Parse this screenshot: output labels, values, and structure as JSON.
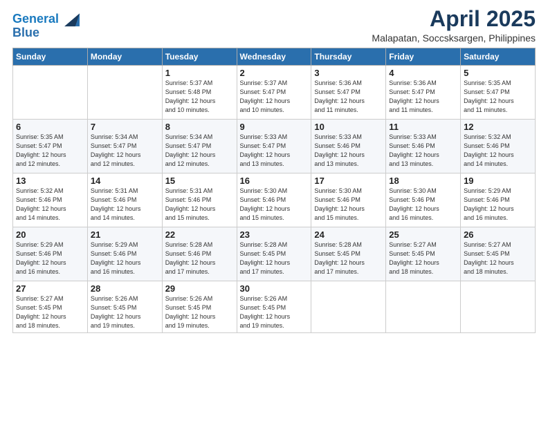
{
  "logo": {
    "line1": "General",
    "line2": "Blue"
  },
  "title": "April 2025",
  "subtitle": "Malapatan, Soccsksargen, Philippines",
  "weekdays": [
    "Sunday",
    "Monday",
    "Tuesday",
    "Wednesday",
    "Thursday",
    "Friday",
    "Saturday"
  ],
  "weeks": [
    [
      {
        "day": "",
        "info": ""
      },
      {
        "day": "",
        "info": ""
      },
      {
        "day": "1",
        "info": "Sunrise: 5:37 AM\nSunset: 5:48 PM\nDaylight: 12 hours\nand 10 minutes."
      },
      {
        "day": "2",
        "info": "Sunrise: 5:37 AM\nSunset: 5:47 PM\nDaylight: 12 hours\nand 10 minutes."
      },
      {
        "day": "3",
        "info": "Sunrise: 5:36 AM\nSunset: 5:47 PM\nDaylight: 12 hours\nand 11 minutes."
      },
      {
        "day": "4",
        "info": "Sunrise: 5:36 AM\nSunset: 5:47 PM\nDaylight: 12 hours\nand 11 minutes."
      },
      {
        "day": "5",
        "info": "Sunrise: 5:35 AM\nSunset: 5:47 PM\nDaylight: 12 hours\nand 11 minutes."
      }
    ],
    [
      {
        "day": "6",
        "info": "Sunrise: 5:35 AM\nSunset: 5:47 PM\nDaylight: 12 hours\nand 12 minutes."
      },
      {
        "day": "7",
        "info": "Sunrise: 5:34 AM\nSunset: 5:47 PM\nDaylight: 12 hours\nand 12 minutes."
      },
      {
        "day": "8",
        "info": "Sunrise: 5:34 AM\nSunset: 5:47 PM\nDaylight: 12 hours\nand 12 minutes."
      },
      {
        "day": "9",
        "info": "Sunrise: 5:33 AM\nSunset: 5:47 PM\nDaylight: 12 hours\nand 13 minutes."
      },
      {
        "day": "10",
        "info": "Sunrise: 5:33 AM\nSunset: 5:46 PM\nDaylight: 12 hours\nand 13 minutes."
      },
      {
        "day": "11",
        "info": "Sunrise: 5:33 AM\nSunset: 5:46 PM\nDaylight: 12 hours\nand 13 minutes."
      },
      {
        "day": "12",
        "info": "Sunrise: 5:32 AM\nSunset: 5:46 PM\nDaylight: 12 hours\nand 14 minutes."
      }
    ],
    [
      {
        "day": "13",
        "info": "Sunrise: 5:32 AM\nSunset: 5:46 PM\nDaylight: 12 hours\nand 14 minutes."
      },
      {
        "day": "14",
        "info": "Sunrise: 5:31 AM\nSunset: 5:46 PM\nDaylight: 12 hours\nand 14 minutes."
      },
      {
        "day": "15",
        "info": "Sunrise: 5:31 AM\nSunset: 5:46 PM\nDaylight: 12 hours\nand 15 minutes."
      },
      {
        "day": "16",
        "info": "Sunrise: 5:30 AM\nSunset: 5:46 PM\nDaylight: 12 hours\nand 15 minutes."
      },
      {
        "day": "17",
        "info": "Sunrise: 5:30 AM\nSunset: 5:46 PM\nDaylight: 12 hours\nand 15 minutes."
      },
      {
        "day": "18",
        "info": "Sunrise: 5:30 AM\nSunset: 5:46 PM\nDaylight: 12 hours\nand 16 minutes."
      },
      {
        "day": "19",
        "info": "Sunrise: 5:29 AM\nSunset: 5:46 PM\nDaylight: 12 hours\nand 16 minutes."
      }
    ],
    [
      {
        "day": "20",
        "info": "Sunrise: 5:29 AM\nSunset: 5:46 PM\nDaylight: 12 hours\nand 16 minutes."
      },
      {
        "day": "21",
        "info": "Sunrise: 5:29 AM\nSunset: 5:46 PM\nDaylight: 12 hours\nand 16 minutes."
      },
      {
        "day": "22",
        "info": "Sunrise: 5:28 AM\nSunset: 5:46 PM\nDaylight: 12 hours\nand 17 minutes."
      },
      {
        "day": "23",
        "info": "Sunrise: 5:28 AM\nSunset: 5:45 PM\nDaylight: 12 hours\nand 17 minutes."
      },
      {
        "day": "24",
        "info": "Sunrise: 5:28 AM\nSunset: 5:45 PM\nDaylight: 12 hours\nand 17 minutes."
      },
      {
        "day": "25",
        "info": "Sunrise: 5:27 AM\nSunset: 5:45 PM\nDaylight: 12 hours\nand 18 minutes."
      },
      {
        "day": "26",
        "info": "Sunrise: 5:27 AM\nSunset: 5:45 PM\nDaylight: 12 hours\nand 18 minutes."
      }
    ],
    [
      {
        "day": "27",
        "info": "Sunrise: 5:27 AM\nSunset: 5:45 PM\nDaylight: 12 hours\nand 18 minutes."
      },
      {
        "day": "28",
        "info": "Sunrise: 5:26 AM\nSunset: 5:45 PM\nDaylight: 12 hours\nand 19 minutes."
      },
      {
        "day": "29",
        "info": "Sunrise: 5:26 AM\nSunset: 5:45 PM\nDaylight: 12 hours\nand 19 minutes."
      },
      {
        "day": "30",
        "info": "Sunrise: 5:26 AM\nSunset: 5:45 PM\nDaylight: 12 hours\nand 19 minutes."
      },
      {
        "day": "",
        "info": ""
      },
      {
        "day": "",
        "info": ""
      },
      {
        "day": "",
        "info": ""
      }
    ]
  ]
}
